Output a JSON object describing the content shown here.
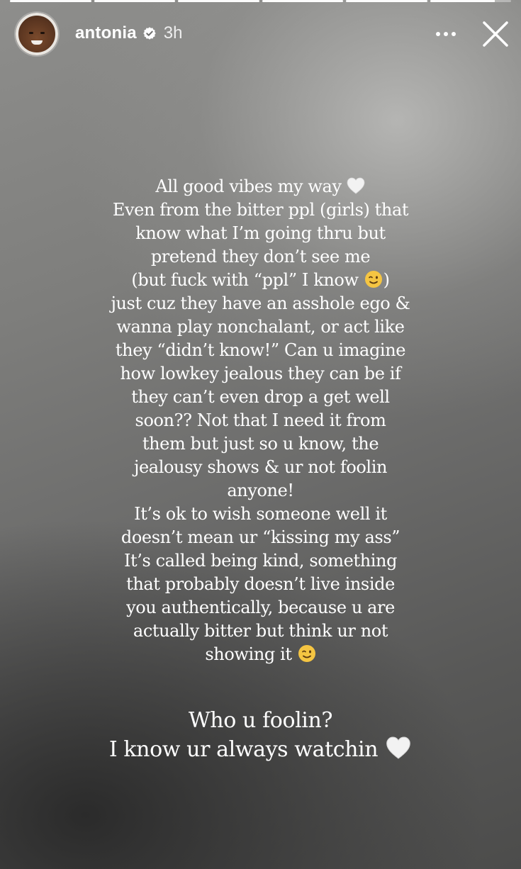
{
  "progress": {
    "segments": [
      1,
      1,
      1,
      1,
      1,
      0.8
    ]
  },
  "header": {
    "username": "antonia",
    "time": "3h",
    "more_icon": "more-horizontal-icon",
    "close_icon": "close-icon",
    "verified_color": "#ffffff"
  },
  "story": {
    "lines": [
      "All good vibes my way",
      "Even from the bitter ppl (girls) that",
      "know what I’m going thru but",
      "pretend they don’t see me",
      "(but fuck with “ppl” I know",
      "just cuz they have an asshole ego &",
      "wanna play nonchalant, or act like",
      "they “didn’t know!” Can u imagine",
      "how lowkey jealous they can be if",
      "they can’t even drop a get well",
      "soon?? Not that I need it from",
      "them but just so u know, the",
      "jealousy shows & ur not foolin",
      "anyone!",
      "It’s ok to wish someone well it",
      "doesn’t mean ur “kissing my ass”",
      "It’s called being kind, something",
      "that probably doesn’t live inside",
      "you authentically, because u are",
      "actually bitter but think ur not",
      "showing it"
    ],
    "close_paren": ")",
    "closing": [
      "Who u foolin?",
      "I know ur always watchin"
    ],
    "emoji": {
      "heart": "white-heart-icon",
      "wink": "winking-face-icon"
    }
  }
}
